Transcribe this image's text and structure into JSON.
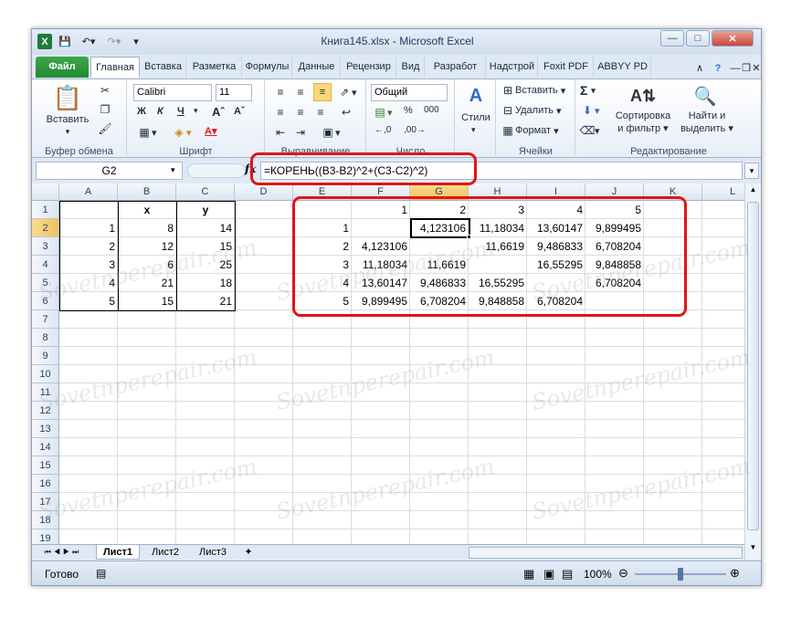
{
  "window": {
    "title": "Книга145.xlsx - Microsoft Excel"
  },
  "tabs": [
    "Файл",
    "Главная",
    "Вставка",
    "Разметка",
    "Формулы",
    "Данные",
    "Рецензир",
    "Вид",
    "Разработ",
    "Надстрой",
    "Foxit PDF",
    "ABBYY PD"
  ],
  "ribbon": {
    "clipboard": {
      "paste": "Вставить",
      "label": "Буфер обмена"
    },
    "font": {
      "name": "Calibri",
      "size": "11",
      "label": "Шрифт",
      "bold": "Ж",
      "italic": "К",
      "underline": "Ч",
      "font_color_letter": "A"
    },
    "alignment": {
      "label": "Выравнивание"
    },
    "number": {
      "format": "Общий",
      "percent": "%",
      "thousands": "000",
      "label": "Число"
    },
    "styles": {
      "label": "Стили"
    },
    "cells": {
      "insert": "Вставить",
      "delete": "Удалить",
      "format": "Формат",
      "label": "Ячейки"
    },
    "editing": {
      "sort_line1": "Сортировка",
      "sort_line2": "и фильтр",
      "find_line1": "Найти и",
      "find_line2": "выделить",
      "label": "Редактирование"
    }
  },
  "formula_bar": {
    "name_box": "G2",
    "fx": "fx",
    "formula": "=КОРЕНЬ((B3-B2)^2+(C3-C2)^2)"
  },
  "sheet": {
    "columns": [
      "A",
      "B",
      "C",
      "D",
      "E",
      "F",
      "G",
      "H",
      "I",
      "J",
      "K",
      "L"
    ],
    "rows": [
      "1",
      "2",
      "3",
      "4",
      "5",
      "6",
      "7",
      "8",
      "9",
      "10",
      "11",
      "12",
      "13",
      "14",
      "15",
      "16",
      "17",
      "18",
      "19"
    ],
    "header_x": "x",
    "header_y": "y",
    "points": [
      {
        "n": "1",
        "x": "8",
        "y": "14"
      },
      {
        "n": "2",
        "x": "12",
        "y": "15"
      },
      {
        "n": "3",
        "x": "6",
        "y": "25"
      },
      {
        "n": "4",
        "x": "21",
        "y": "18"
      },
      {
        "n": "5",
        "x": "15",
        "y": "21"
      }
    ],
    "matrix_header": [
      "1",
      "2",
      "3",
      "4",
      "5"
    ],
    "matrix": [
      {
        "label": "1",
        "values": [
          "",
          "4,123106",
          "11,18034",
          "13,60147",
          "9,899495"
        ]
      },
      {
        "label": "2",
        "values": [
          "4,123106",
          "",
          "11,6619",
          "9,486833",
          "6,708204"
        ]
      },
      {
        "label": "3",
        "values": [
          "11,18034",
          "11,6619",
          "",
          "16,55295",
          "9,848858"
        ]
      },
      {
        "label": "4",
        "values": [
          "13,60147",
          "9,486833",
          "16,55295",
          "",
          "6,708204"
        ]
      },
      {
        "label": "5",
        "values": [
          "9,899495",
          "6,708204",
          "9,848858",
          "6,708204",
          ""
        ]
      }
    ]
  },
  "sheet_tabs": [
    "Лист1",
    "Лист2",
    "Лист3"
  ],
  "status": {
    "ready": "Готово",
    "zoom": "100%"
  },
  "watermark": "Sovetnperepair.com",
  "colors": {
    "accent": "#e11515",
    "file_tab": "#2e9a3e"
  }
}
